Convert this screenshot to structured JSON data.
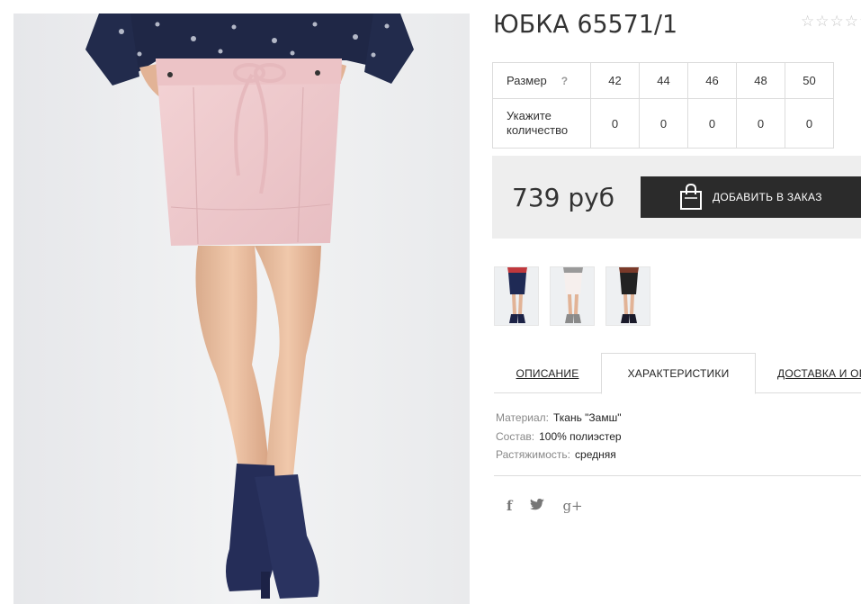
{
  "product": {
    "title": "ЮБКА 65571/1",
    "rating": {
      "stars_total": 5,
      "stars_filled": 0,
      "star_char": "☆"
    }
  },
  "sizes": {
    "size_label": "Размер",
    "help": "?",
    "qty_label": "Укажите количество",
    "items": [
      {
        "size": "42",
        "qty": "0"
      },
      {
        "size": "44",
        "qty": "0"
      },
      {
        "size": "46",
        "qty": "0"
      },
      {
        "size": "48",
        "qty": "0"
      },
      {
        "size": "50",
        "qty": "0"
      }
    ]
  },
  "price": {
    "value": "739 руб",
    "button_label": "ДОБАВИТЬ В ЗАКАЗ",
    "button_icon": "shopping-bag-icon"
  },
  "thumbnails": [
    {
      "name": "navy-skirt",
      "color": "#1f2a55"
    },
    {
      "name": "white-skirt",
      "color": "#f3ecea"
    },
    {
      "name": "black-skirt",
      "color": "#222222"
    }
  ],
  "tabs": [
    {
      "label": "ОПИСАНИЕ",
      "active": false
    },
    {
      "label": "ХАРАКТЕРИСТИКИ",
      "active": true
    },
    {
      "label": "ДОСТАВКА И ОП",
      "active": false
    }
  ],
  "specs": [
    {
      "label": "Материал:",
      "value": "Ткань \"Замш\""
    },
    {
      "label": "Состав:",
      "value": "100% полиэстер"
    },
    {
      "label": "Растяжимость:",
      "value": "средняя"
    }
  ],
  "share": {
    "facebook": "f",
    "twitter": "t",
    "googleplus": "g+"
  },
  "colors": {
    "skirt": "#efc9cc",
    "boots": "#27305a",
    "button_bg": "#2b2b2b",
    "price_bg": "#eeeeee"
  }
}
